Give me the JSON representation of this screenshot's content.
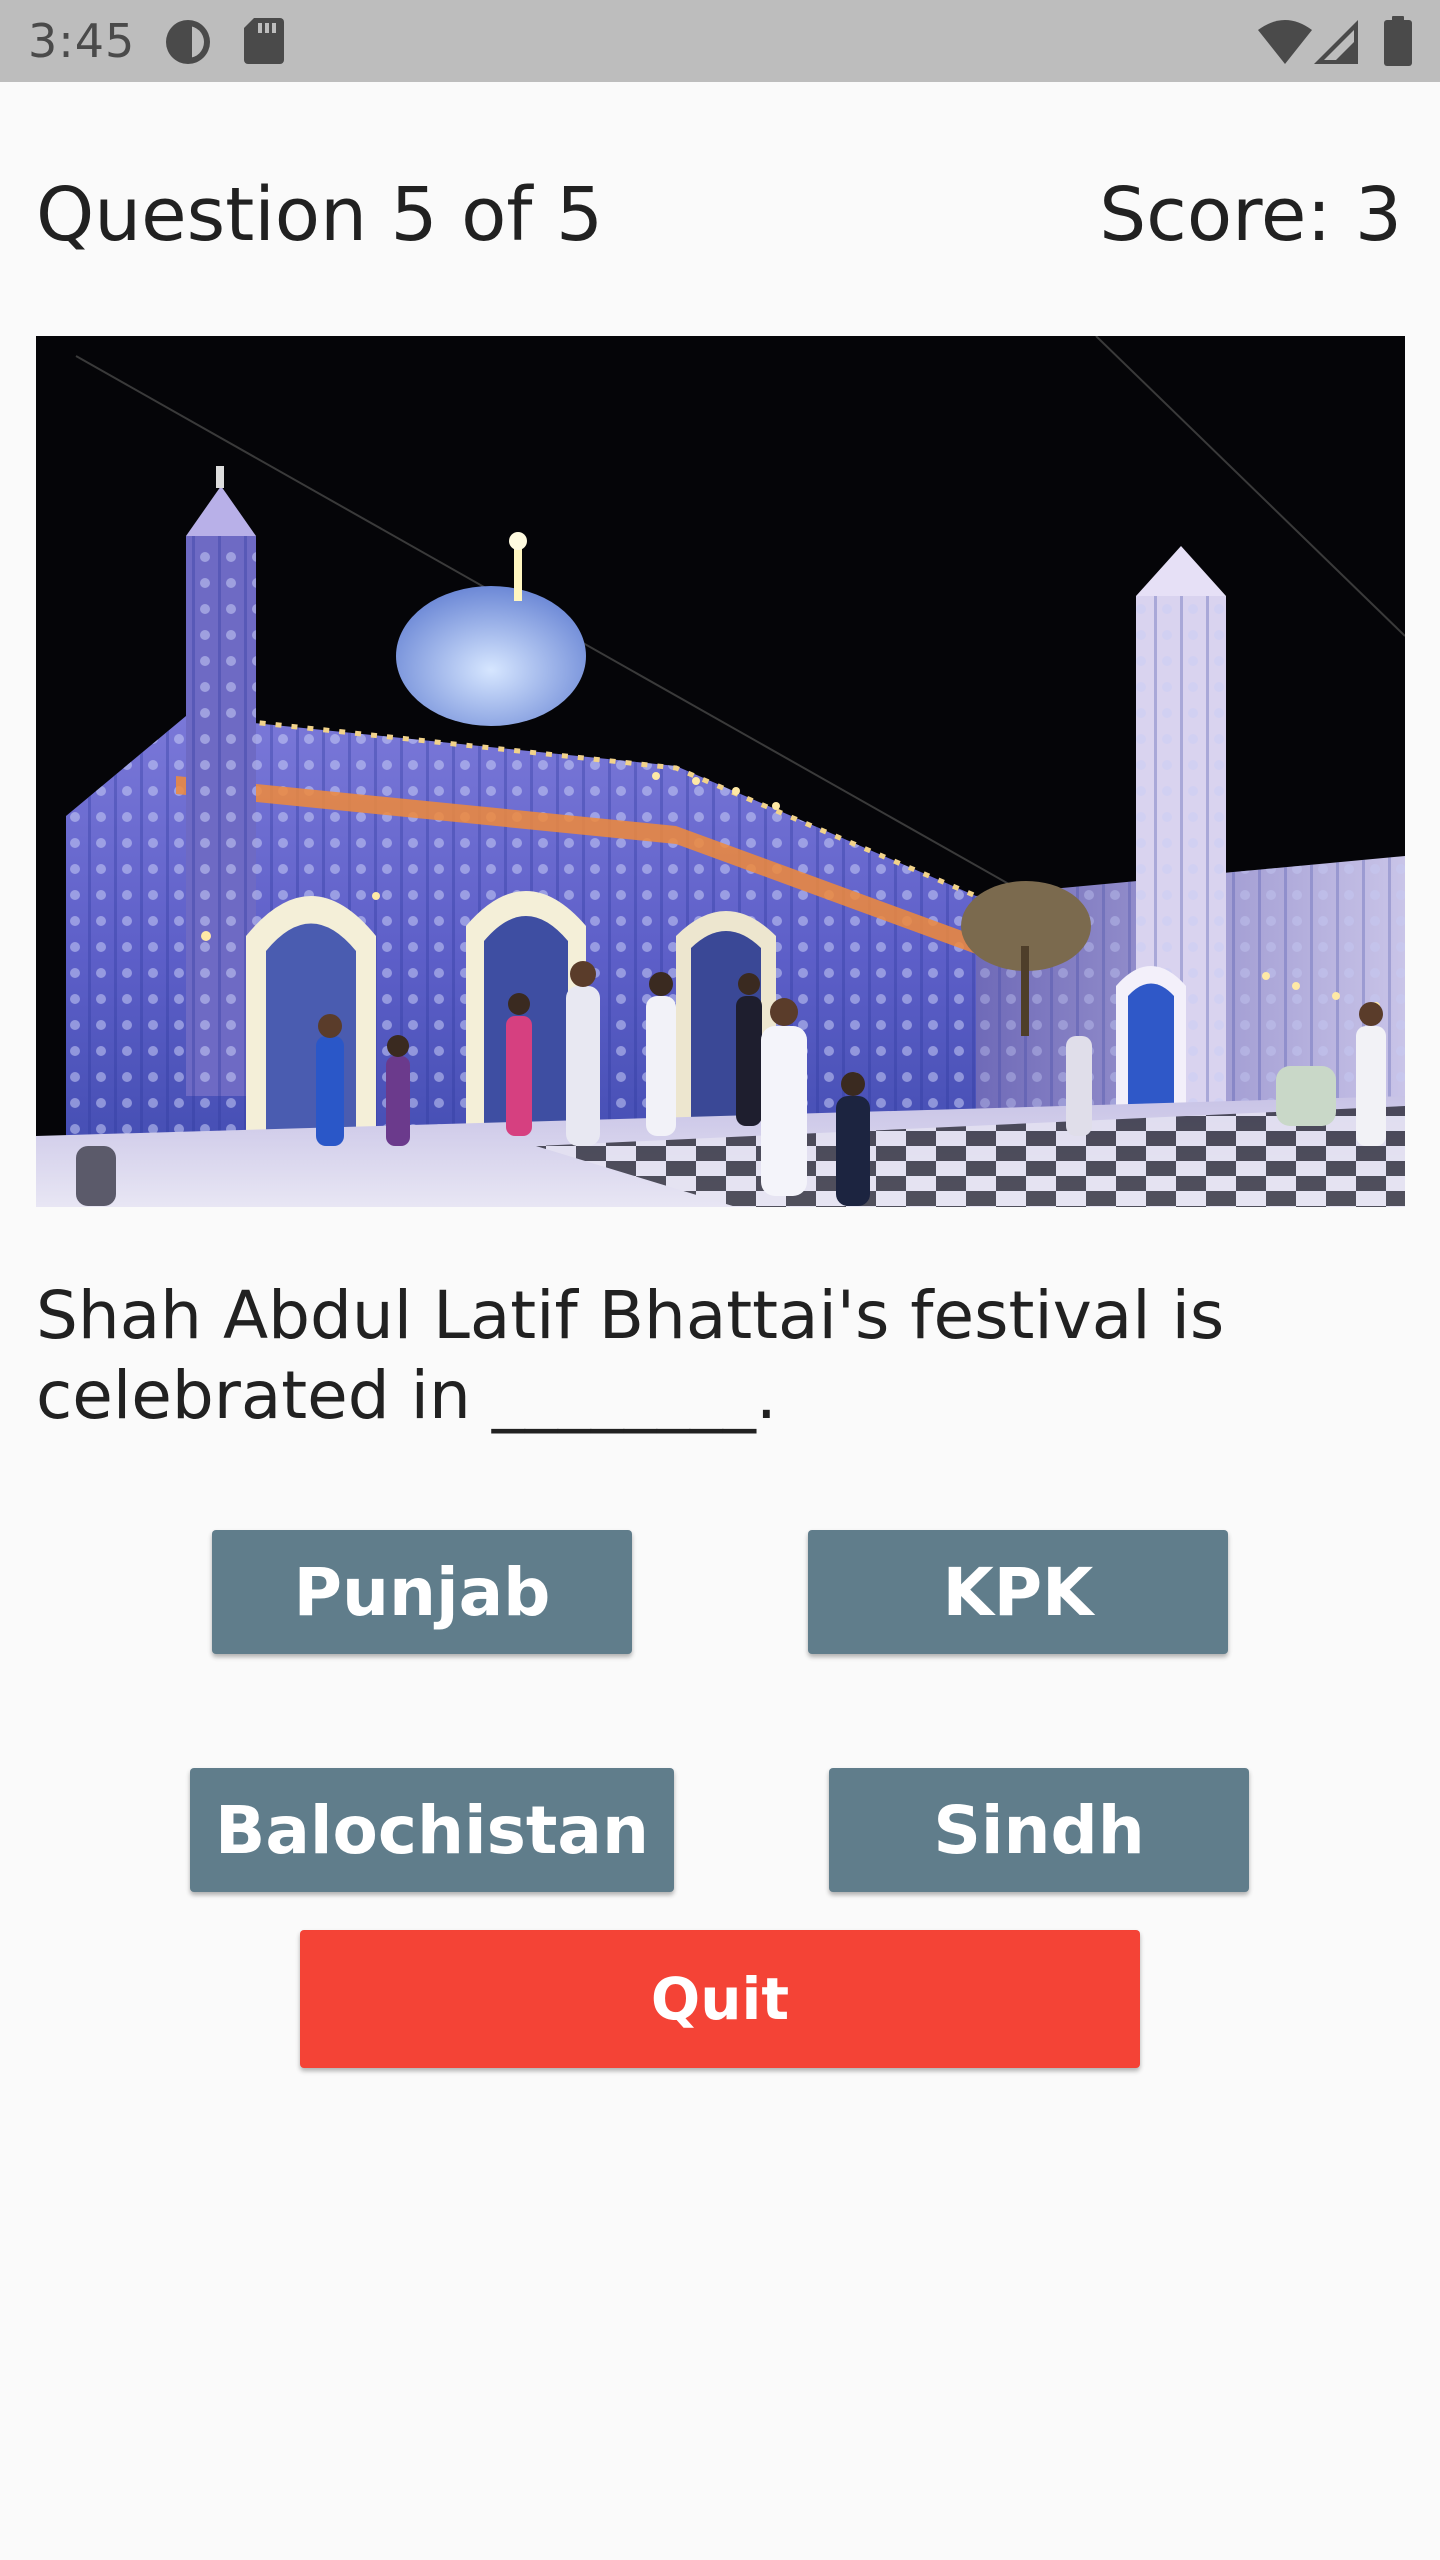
{
  "status_bar": {
    "time": "3:45",
    "icons": [
      "data-saver-icon",
      "sd-card-icon",
      "wifi-icon",
      "signal-icon",
      "battery-icon"
    ]
  },
  "quiz": {
    "question_counter": "Question 5 of 5",
    "score": "Score: 3",
    "image_icon": "shrine-photo",
    "question": "Shah Abdul Latif Bhattai's festival is celebrated in ________.",
    "answers": [
      "Punjab",
      "KPK",
      "Balochistan",
      "Sindh"
    ],
    "quit_label": "Quit"
  },
  "colors": {
    "status_bar": "#BDBDBD",
    "background": "#FAFAFA",
    "answer_button": "#607D8B",
    "quit_button": "#F44336",
    "text": "#212121"
  }
}
